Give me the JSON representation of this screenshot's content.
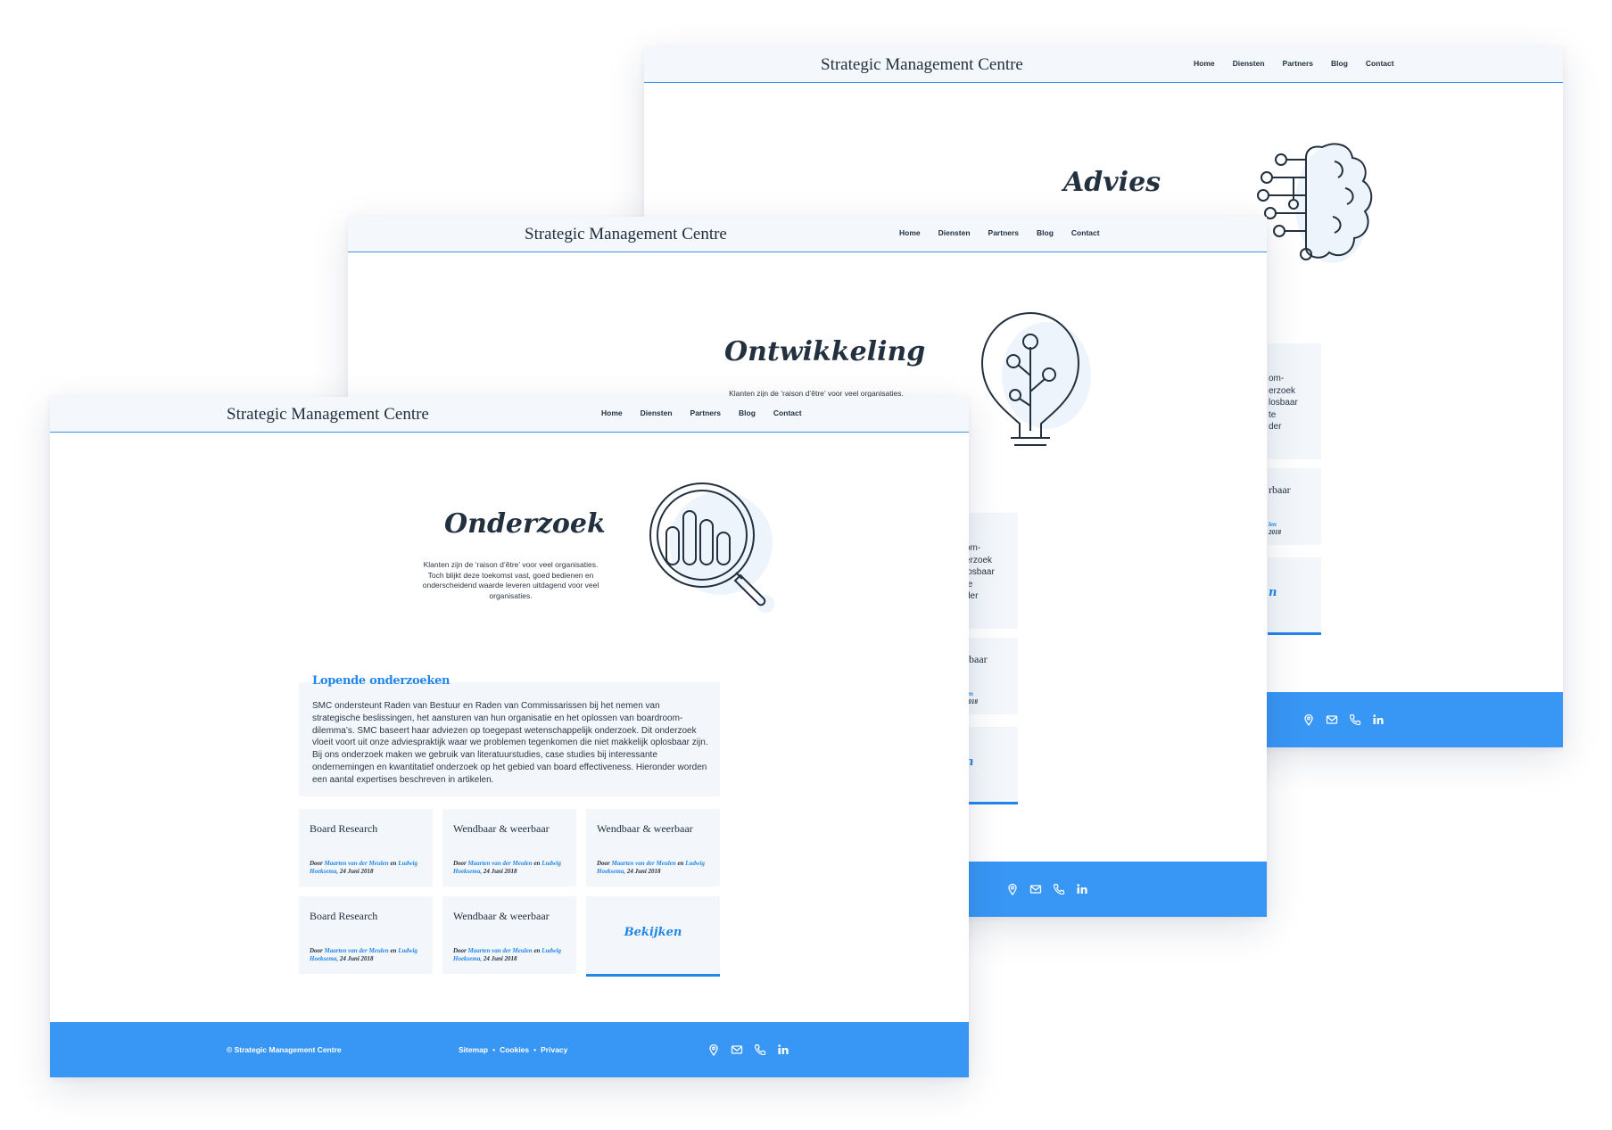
{
  "brand": "Strategic Management Centre",
  "nav": [
    "Home",
    "Diensten",
    "Partners",
    "Blog",
    "Contact"
  ],
  "footer": {
    "copyright": "© Strategic Management Centre",
    "links": [
      "Sitemap",
      "•",
      "Cookies",
      "•",
      "Privacy"
    ],
    "icons": [
      "location-icon",
      "mail-icon",
      "phone-icon",
      "linkedin-icon"
    ]
  },
  "colors": {
    "accent": "#3896f5",
    "link": "#2186ea",
    "text": "#22303f",
    "card": "#f3f7fb"
  },
  "pages": {
    "advies": {
      "title": "Advies",
      "fragments": {
        "text": [
          "om-",
          "erzoek",
          "losbaar",
          "te",
          "der"
        ],
        "card_title": "rbaar",
        "meta_name": "len",
        "meta_date": "2018",
        "cta": "n"
      }
    },
    "ontwikkeling": {
      "title": "Ontwikkeling",
      "intro": "Klanten zijn de ‘raison d’être’ voor veel organisaties.",
      "fragments": {
        "text": [
          "om-",
          "erzoek",
          "losbaar",
          "te",
          "der"
        ],
        "card_title": "rbaar",
        "meta_name": "len",
        "meta_date": "2018",
        "cta": "n"
      }
    },
    "onderzoek": {
      "title": "Onderzoek",
      "intro": "Klanten zijn de ‘raison d’être’ voor veel organisaties. Toch blijkt deze toekomst vast, goed bedienen en onderscheidend waarde leveren uitdagend voor veel organisaties.",
      "section_title": "Lopende onderzoeken",
      "section_text": "SMC ondersteunt Raden van Bestuur en Raden van Commissarissen bij het nemen van strategische beslissingen, het aansturen van hun organisatie en het oplossen van boardroom-dilemma’s. SMC baseert haar adviezen op toegepast wetenschappelijk onderzoek. Dit onderzoek vloeit voort uit onze adviespraktijk waar we problemen tegenkomen die niet makkelijk oplosbaar zijn. Bij ons onderzoek maken we gebruik van literatuurstudies, case studies bij interessante ondernemingen en kwantitatief onderzoek op het gebied van board effectiveness. Hieronder worden een aantal expertises beschreven in artikelen.",
      "cards": [
        {
          "title": "Board Research",
          "by": "Door",
          "author1": "Maarten van der Meulen",
          "and": "en",
          "author2": "Ludwig Hoeksema,",
          "date": "24 Juni 2018"
        },
        {
          "title": "Wendbaar & weerbaar",
          "by": "Door",
          "author1": "Maarten van der Meulen",
          "and": "en",
          "author2": "Ludwig Hoeksema,",
          "date": "24 Juni 2018"
        },
        {
          "title": "Wendbaar & weerbaar",
          "by": "Door",
          "author1": "Maarten van der Meulen",
          "and": "en",
          "author2": "Ludwig Hoeksema,",
          "date": "24 Juni 2018"
        },
        {
          "title": "Board Research",
          "by": "Door",
          "author1": "Maarten van der Meulen",
          "and": "en",
          "author2": "Ludwig Hoeksema,",
          "date": "24 Juni 2018"
        },
        {
          "title": "Wendbaar & weerbaar",
          "by": "Door",
          "author1": "Maarten van der Meulen",
          "and": "en",
          "author2": "Ludwig Hoeksema,",
          "date": "24 Juni 2018"
        }
      ],
      "cta": "Bekijken"
    }
  }
}
